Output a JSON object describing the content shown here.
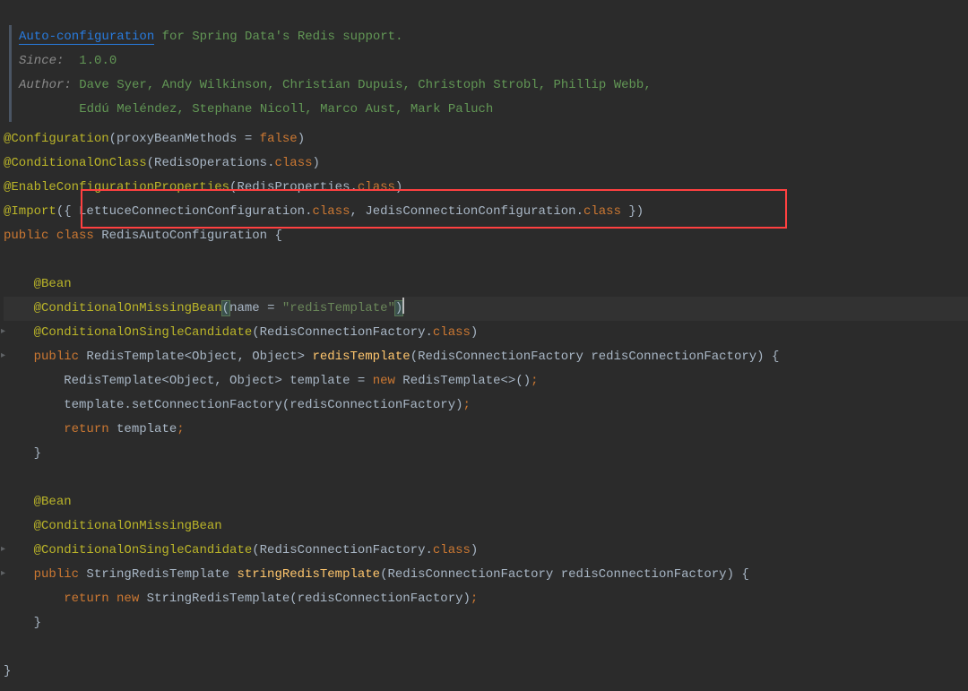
{
  "javadoc": {
    "link_text": "Auto-configuration",
    "desc_rest": " for Spring Data's Redis support.",
    "since_label": "Since:",
    "since_value": "1.0.0",
    "author_label": "Author:",
    "author_line1": "Dave Syer, Andy Wilkinson, Christian Dupuis, Christoph Strobl, Phillip Webb,",
    "author_line2": "Eddú Meléndez, Stephane Nicoll, Marco Aust, Mark Paluch"
  },
  "code": {
    "l1_anno": "@Configuration",
    "l1_open": "(",
    "l1_param": "proxyBeanMethods = ",
    "l1_false": "false",
    "l1_close": ")",
    "l2_anno": "@ConditionalOnClass",
    "l2_open": "(",
    "l2_arg": "RedisOperations",
    "l2_dot": ".",
    "l2_class": "class",
    "l2_close": ")",
    "l3_anno": "@EnableConfigurationProperties",
    "l3_open": "(",
    "l3_arg": "RedisProperties",
    "l3_dot": ".",
    "l3_class": "class",
    "l3_close": ")",
    "l4_anno": "@Import",
    "l4_open": "({ ",
    "l4_a1": "LettuceConnectionConfiguration",
    "l4_d1": ".",
    "l4_c1": "class",
    "l4_comma": ", ",
    "l4_a2": "JedisConnectionConfiguration",
    "l4_d2": ".",
    "l4_c2": "class",
    "l4_close": " })",
    "l5_pub": "public ",
    "l5_class": "class ",
    "l5_name": "RedisAutoConfiguration ",
    "l5_brace": "{",
    "l7_indent": "    ",
    "l7_anno": "@Bean",
    "l8_indent": "    ",
    "l8_anno": "@ConditionalOnMissingBean",
    "l8_open": "(",
    "l8_param": "name = ",
    "l8_str": "\"redisTemplate\"",
    "l8_close": ")",
    "l9_indent": "    ",
    "l9_anno": "@ConditionalOnSingleCandidate",
    "l9_open": "(",
    "l9_arg": "RedisConnectionFactory",
    "l9_dot": ".",
    "l9_class": "class",
    "l9_close": ")",
    "l10_indent": "    ",
    "l10_pub": "public ",
    "l10_type": "RedisTemplate<Object, Object> ",
    "l10_method": "redisTemplate",
    "l10_open": "(",
    "l10_ptype": "RedisConnectionFactory ",
    "l10_pname": "redisConnectionFactory",
    "l10_close": ") {",
    "l11_indent": "        ",
    "l11_text": "RedisTemplate<Object, Object> template = ",
    "l11_new": "new ",
    "l11_ctor": "RedisTemplate<>()",
    "l11_semi": ";",
    "l12_indent": "        ",
    "l12_text": "template.setConnectionFactory(redisConnectionFactory)",
    "l12_semi": ";",
    "l13_indent": "        ",
    "l13_ret": "return ",
    "l13_var": "template",
    "l13_semi": ";",
    "l14_indent": "    ",
    "l14_brace": "}",
    "l16_indent": "    ",
    "l16_anno": "@Bean",
    "l17_indent": "    ",
    "l17_anno": "@ConditionalOnMissingBean",
    "l18_indent": "    ",
    "l18_anno": "@ConditionalOnSingleCandidate",
    "l18_open": "(",
    "l18_arg": "RedisConnectionFactory",
    "l18_dot": ".",
    "l18_class": "class",
    "l18_close": ")",
    "l19_indent": "    ",
    "l19_pub": "public ",
    "l19_type": "StringRedisTemplate ",
    "l19_method": "stringRedisTemplate",
    "l19_open": "(",
    "l19_ptype": "RedisConnectionFactory ",
    "l19_pname": "redisConnectionFactory",
    "l19_close": ") {",
    "l20_indent": "        ",
    "l20_ret": "return ",
    "l20_new": "new ",
    "l20_ctor": "StringRedisTemplate(redisConnectionFactory)",
    "l20_semi": ";",
    "l21_indent": "    ",
    "l21_brace": "}",
    "l23_brace": "}"
  }
}
